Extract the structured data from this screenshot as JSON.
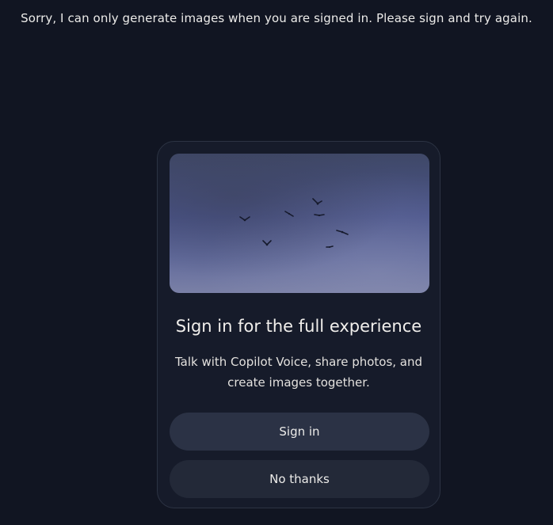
{
  "chat": {
    "assistant_message": "Sorry, I can only generate images when you are signed in. Please sign and try again."
  },
  "signin_card": {
    "image_icon": "birds-in-sky-illustration",
    "title": "Sign in for the full experience",
    "description": "Talk with Copilot Voice, share photos, and create images together.",
    "sign_in_label": "Sign in",
    "no_thanks_label": "No thanks"
  },
  "colors": {
    "background": "#111522",
    "card": "#161b2a",
    "primary_button": "#2b3245",
    "secondary_button": "#232938"
  }
}
